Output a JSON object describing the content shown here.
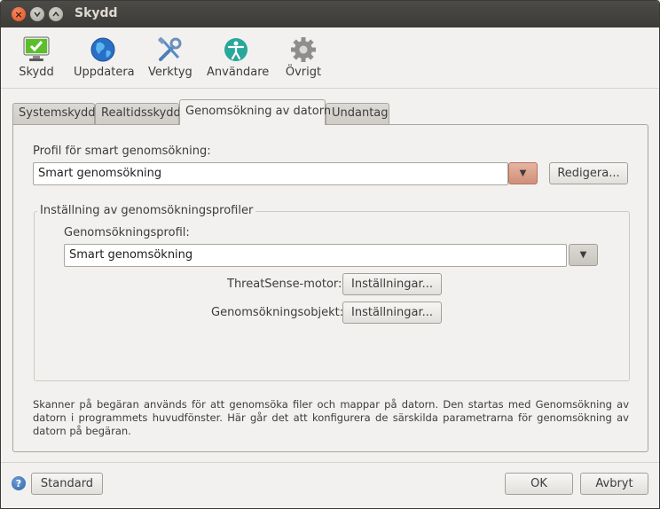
{
  "window": {
    "title": "Skydd"
  },
  "toolbar": {
    "items": [
      {
        "label": "Skydd",
        "icon": "monitor-check-icon"
      },
      {
        "label": "Uppdatera",
        "icon": "globe-icon"
      },
      {
        "label": "Verktyg",
        "icon": "tools-icon"
      },
      {
        "label": "Användare",
        "icon": "accessibility-icon"
      },
      {
        "label": "Övrigt",
        "icon": "gear-icon"
      }
    ]
  },
  "tabs": [
    {
      "label": "Systemskydd"
    },
    {
      "label": "Realtidsskydd"
    },
    {
      "label": "Genomsökning av datorn",
      "active": true
    },
    {
      "label": "Undantag"
    }
  ],
  "panel": {
    "profile_label": "Profil för smart genomsökning:",
    "profile_value": "Smart genomsökning",
    "edit_button": "Redigera...",
    "group_title": "Inställning av genomsökningsprofiler",
    "scan_profile_label": "Genomsökningsprofil:",
    "scan_profile_value": "Smart genomsökning",
    "engine_label": "ThreatSense-motor:",
    "engine_button": "Inställningar...",
    "objects_label": "Genomsökningsobjekt:",
    "objects_button": "Inställningar...",
    "description": "Skanner på begäran används för att genomsöka filer och mappar på datorn. Den startas med Genomsökning av datorn i programmets huvudfönster. Här går det att konfigurera de särskilda parametrarna för genomsökning av datorn på begäran."
  },
  "footer": {
    "standard_button": "Standard",
    "ok_button": "OK",
    "cancel_button": "Avbryt"
  },
  "colors": {
    "accent_arrow": "#d08f78",
    "titlebar": "#3c3b37"
  }
}
